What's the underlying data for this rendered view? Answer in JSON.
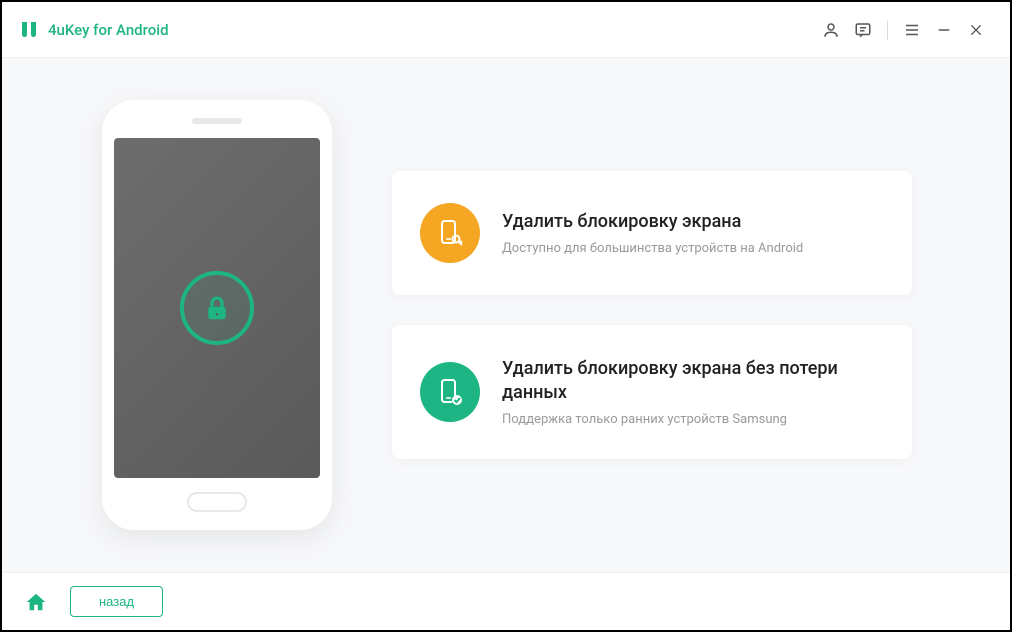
{
  "app": {
    "title": "4uKey for Android"
  },
  "options": {
    "remove_lock": {
      "title": "Удалить блокировку экрана",
      "subtitle": "Доступно для большинства устройств на Android"
    },
    "remove_lock_no_data_loss": {
      "title": "Удалить блокировку экрана без потери данных",
      "subtitle": "Поддержка только ранних устройств Samsung"
    }
  },
  "footer": {
    "back_label": "назад"
  },
  "colors": {
    "primary": "#1db584",
    "accent_orange": "#f5a623"
  }
}
